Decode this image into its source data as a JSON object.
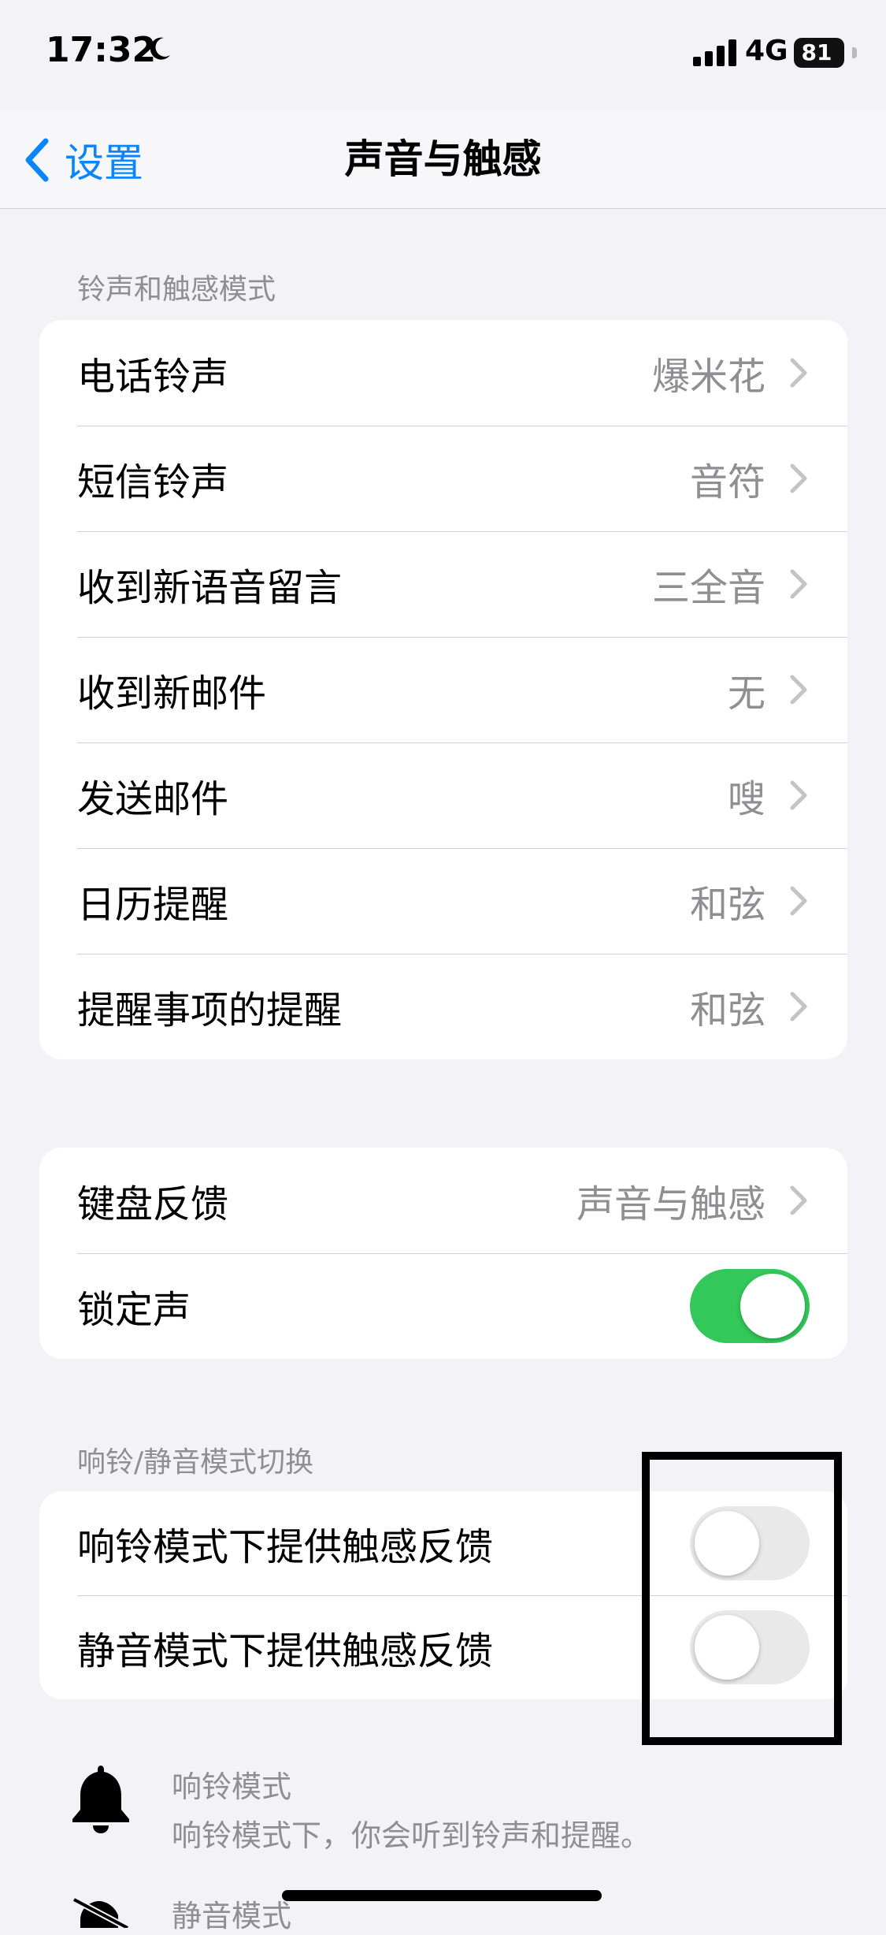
{
  "status_bar": {
    "time": "17:32",
    "network": "4G",
    "battery": "81",
    "icons": [
      "moon-icon",
      "signal-bars-icon",
      "battery-icon"
    ]
  },
  "nav": {
    "back_label": "设置",
    "title": "声音与触感"
  },
  "sections": {
    "ringtones_header": "铃声和触感模式",
    "switch_header": "响铃/静音模式切换"
  },
  "ringtones": [
    {
      "label": "电话铃声",
      "value": "爆米花"
    },
    {
      "label": "短信铃声",
      "value": "音符"
    },
    {
      "label": "收到新语音留言",
      "value": "三全音"
    },
    {
      "label": "收到新邮件",
      "value": "无"
    },
    {
      "label": "发送邮件",
      "value": "嗖"
    },
    {
      "label": "日历提醒",
      "value": "和弦"
    },
    {
      "label": "提醒事项的提醒",
      "value": "和弦"
    }
  ],
  "feedback": {
    "keyboard_label": "键盘反馈",
    "keyboard_value": "声音与触感",
    "lock_label": "锁定声",
    "lock_on": true
  },
  "haptics": [
    {
      "label": "响铃模式下提供触感反馈",
      "on": false
    },
    {
      "label": "静音模式下提供触感反馈",
      "on": false
    }
  ],
  "modes": {
    "ring_title": "响铃模式",
    "ring_desc": "响铃模式下，你会听到铃声和提醒。",
    "silent_title": "静音模式"
  },
  "colors": {
    "accent": "#0a84ff",
    "toggle_on": "#34c759",
    "toggle_off": "#e9e9ea",
    "secondary_text": "#8e8e93",
    "background": "#f2f2f7"
  }
}
